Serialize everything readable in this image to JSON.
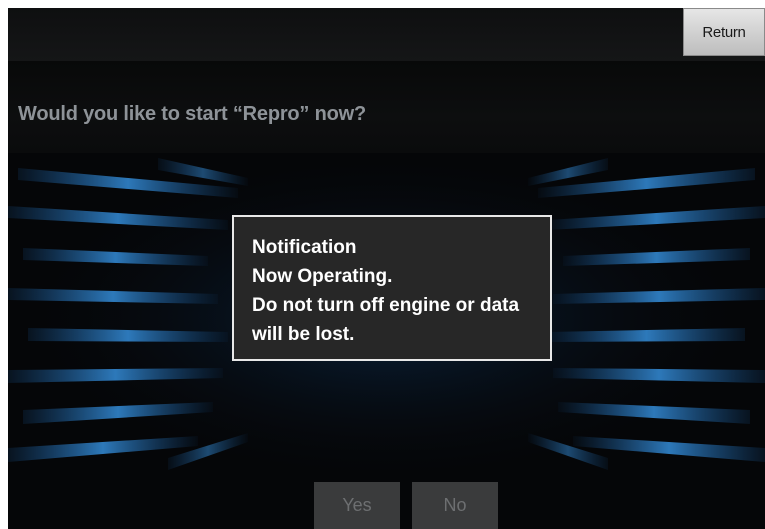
{
  "header": {
    "return_label": "Return"
  },
  "prompt": {
    "question": "Would you like to start “Repro” now?"
  },
  "dialog": {
    "title": "Notification",
    "line1": "Now Operating.",
    "line2": "Do not turn off engine or data",
    "line3": "will be lost."
  },
  "actions": {
    "yes_label": "Yes",
    "no_label": "No"
  },
  "colors": {
    "background": "#050608",
    "accent_blue": "#2f8fe0",
    "dialog_bg": "#272727",
    "dialog_border": "#e8e8e8"
  }
}
